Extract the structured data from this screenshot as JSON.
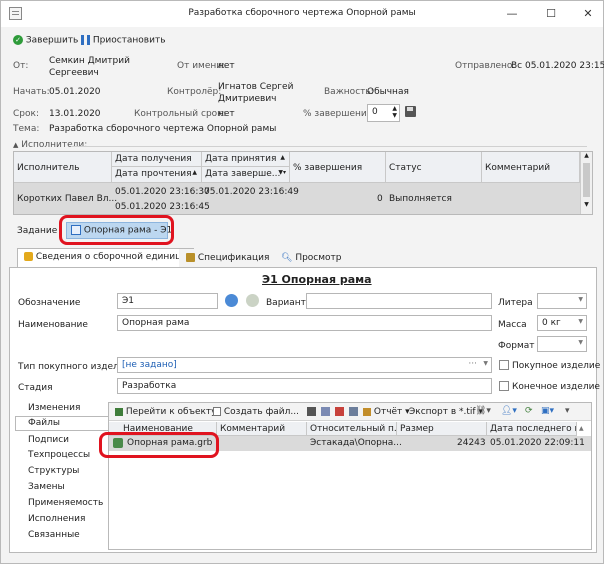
{
  "window": {
    "title": "Разработка сборочного чертежа Опорной рамы",
    "min": "—",
    "max": "☐",
    "close": "✕"
  },
  "toolbar": {
    "finish": "Завершить",
    "pause": "Приостановить"
  },
  "header": {
    "from_label": "От:",
    "from_value": "Семкин Дмитрий Сергеевич",
    "onbehalf_label": "От имени:",
    "onbehalf_value": "нет",
    "sent_label": "Отправлено:",
    "sent_value": "Вс 05.01.2020 23:15",
    "start_label": "Начать:",
    "start_value": "05.01.2020",
    "controller_label": "Контролёр:",
    "controller_value": "Игнатов Сергей Дмитриевич",
    "importance_label": "Важность:",
    "importance_value": "Обычная",
    "due_label": "Срок:",
    "due_value": "13.01.2020",
    "control_label": "Контрольный срок:",
    "control_value": "нет",
    "percent_label": "% завершения:",
    "percent_value": "0",
    "subject_label": "Тема:",
    "subject_value": "Разработка сборочного чертежа Опорной рамы"
  },
  "executors": {
    "section_label": "Исполнители:",
    "col_executor": "Исполнитель",
    "col_received": "Дата получения",
    "col_accepted": "Дата принятия",
    "col_read": "Дата прочтения",
    "col_done": "Дата заверше...",
    "col_percent": "% завершения",
    "col_status": "Статус",
    "col_comment": "Комментарий",
    "row": {
      "executor": "Коротких Павел Вл...",
      "received": "05.01.2020 23:16:37",
      "read": "05.01.2020 23:16:45",
      "accepted": "05.01.2020 23:16:49",
      "percent": "0",
      "status": "Выполняется"
    }
  },
  "task": {
    "label": "Задание",
    "chip": "Опорная рама - Э1"
  },
  "tabs": {
    "t1": "Сведения о сборочной единице",
    "t2": "Спецификация",
    "t3": "Просмотр"
  },
  "unit": {
    "heading": "Э1 Опорная рама",
    "designation_label": "Обозначение",
    "designation_value": "Э1",
    "variant_label": "Вариант",
    "variant_value": "",
    "litera_label": "Литера",
    "litera_value": "",
    "name_label": "Наименование",
    "name_value": "Опорная рама",
    "mass_label": "Масса",
    "mass_value": "0 кг",
    "format_label": "Формат",
    "format_value": "",
    "type_label": "Тип покупного изделия",
    "type_value": "[не задано]",
    "purchased_label": "Покупное изделие",
    "stage_label": "Стадия",
    "stage_value": "Разработка",
    "final_label": "Конечное изделие"
  },
  "nav": [
    "Изменения",
    "Файлы",
    "Подписи",
    "Техпроцессы",
    "Структуры",
    "Замены",
    "Применяемость",
    "Исполнения",
    "Связанные"
  ],
  "files_toolbar": {
    "goto": "Перейти к объекту",
    "create": "Создать файл...",
    "report": "Отчёт",
    "export": "Экспорт в *.tif"
  },
  "files": {
    "col_name": "Наименование",
    "col_comment": "Комментарий",
    "col_path": "Относительный п...",
    "col_size": "Размер",
    "col_date": "Дата последнего и...",
    "row": {
      "name": "Опорная рама.grb",
      "comment": "",
      "path": "Эстакада\\Опорна...",
      "size": "24243",
      "date": "05.01.2020 22:09:11"
    }
  }
}
